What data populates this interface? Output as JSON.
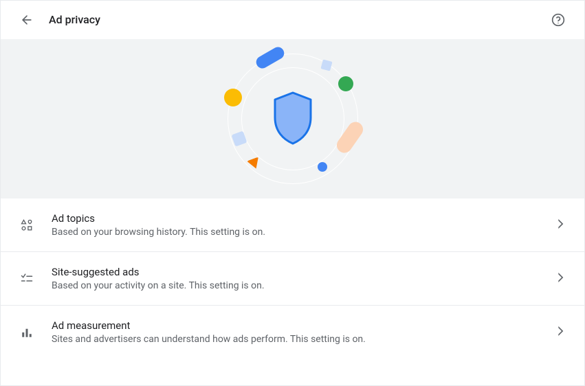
{
  "header": {
    "title": "Ad privacy"
  },
  "rows": [
    {
      "title": "Ad topics",
      "desc": "Based on your browsing history. This setting is on."
    },
    {
      "title": "Site-suggested ads",
      "desc": "Based on your activity on a site. This setting is on."
    },
    {
      "title": "Ad measurement",
      "desc": "Sites and advertisers can understand how ads perform. This setting is on."
    }
  ]
}
